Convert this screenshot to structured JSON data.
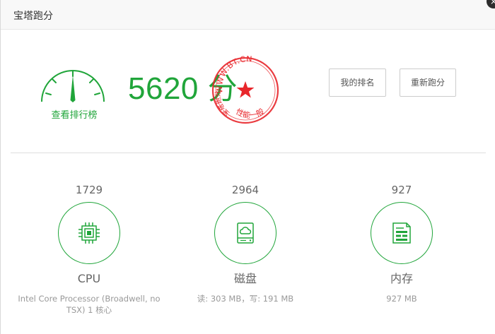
{
  "window": {
    "title": "宝塔跑分",
    "close_glyph": "×"
  },
  "score": {
    "value": "5620",
    "unit": "分",
    "gauge_label": "查看排行榜"
  },
  "stamp": {
    "top_text": "WWW.BT.CN",
    "left_text": "宝塔跑分",
    "bottom_text": "性能一般",
    "color": "#e8262b"
  },
  "buttons": {
    "my_rank": "我的排名",
    "rerun": "重新跑分"
  },
  "metrics": [
    {
      "key": "cpu",
      "value": "1729",
      "name": "CPU",
      "detail": "Intel Core Processor (Broadwell, no TSX) 1 核心",
      "icon": "cpu-chip-icon"
    },
    {
      "key": "disk",
      "value": "2964",
      "name": "磁盘",
      "detail": "读: 303 MB，写: 191 MB",
      "icon": "disk-drive-icon"
    },
    {
      "key": "mem",
      "value": "927",
      "name": "内存",
      "detail": "927 MB",
      "icon": "memory-module-icon"
    }
  ],
  "colors": {
    "accent": "#20a53a",
    "stamp": "#e8262b",
    "divider": "#dddddd"
  }
}
